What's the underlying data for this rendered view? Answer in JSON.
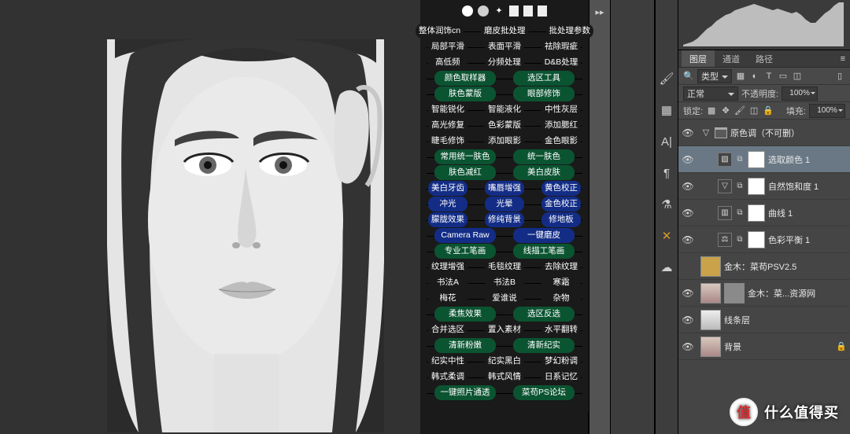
{
  "watermark": {
    "badge": "值",
    "text": "什么值得买"
  },
  "brush_presets": [
    "soft",
    "hard",
    "spark",
    "gauss",
    "streak",
    "streak2"
  ],
  "actions": [
    {
      "color": "dark",
      "cells": [
        "整体润饰cn",
        "磨皮批处理",
        "批处理参数"
      ]
    },
    {
      "color": "dark",
      "cells": [
        "局部平滑",
        "表面平滑",
        "祛除瑕疵"
      ]
    },
    {
      "color": "dark",
      "cells": [
        "高低频",
        "分频处理",
        "D&B处理"
      ]
    },
    {
      "color": "green",
      "cells": [
        "颜色取样器",
        "选区工具"
      ],
      "wide": true
    },
    {
      "color": "green",
      "cells": [
        "肤色蒙版",
        "眼部修饰"
      ],
      "wide": true
    },
    {
      "color": "dark",
      "cells": [
        "智能锐化",
        "智能液化",
        "中性灰层"
      ]
    },
    {
      "color": "dark",
      "cells": [
        "高光修复",
        "色彩蒙版",
        "添加腮红"
      ]
    },
    {
      "color": "dark",
      "cells": [
        "睫毛修饰",
        "添加眼影",
        "金色眼影"
      ]
    },
    {
      "color": "green",
      "cells": [
        "常用统一肤色",
        "统一肤色"
      ],
      "wide": true
    },
    {
      "color": "green",
      "cells": [
        "肤色减红",
        "美白皮肤"
      ],
      "wide": true
    },
    {
      "color": "blue",
      "cells": [
        "美白牙齿",
        "嘴唇增强",
        "黄色校正"
      ]
    },
    {
      "color": "blue",
      "cells": [
        "冲光",
        "光晕",
        "金色校正"
      ]
    },
    {
      "color": "blue",
      "cells": [
        "朦胧效果",
        "修纯背景",
        "修地板"
      ]
    },
    {
      "color": "blue",
      "cells": [
        "Camera Raw",
        "一键磨皮"
      ],
      "wide": true
    },
    {
      "color": "green",
      "cells": [
        "专业工笔画",
        "线描工笔画"
      ],
      "wide": true
    },
    {
      "color": "dark",
      "cells": [
        "纹理增强",
        "毛毯纹理",
        "去除纹理"
      ]
    },
    {
      "color": "dark",
      "cells": [
        "书法A",
        "书法B",
        "寒霜"
      ]
    },
    {
      "color": "dark",
      "cells": [
        "梅花",
        "爱谁说",
        "杂物"
      ]
    },
    {
      "color": "green",
      "cells": [
        "柔焦效果",
        "选区反选"
      ],
      "wide": true
    },
    {
      "color": "dark",
      "cells": [
        "合并选区",
        "置入素材",
        "水平翻转"
      ]
    },
    {
      "color": "green",
      "cells": [
        "清新粉嫩",
        "清新纪实"
      ],
      "wide": true
    },
    {
      "color": "dark",
      "cells": [
        "纪实中性",
        "纪实黑白",
        "梦幻粉调"
      ]
    },
    {
      "color": "dark",
      "cells": [
        "韩式柔调",
        "韩式风情",
        "日系记忆"
      ]
    },
    {
      "color": "green",
      "cells": [
        "一键照片通透",
        "菜苟PS论坛"
      ],
      "wide": true
    }
  ],
  "mini_strip_icons": [
    "expand"
  ],
  "collapsed_icons": [
    "brush",
    "swatches",
    "text",
    "paragraph",
    "beaker",
    "crossed",
    "cloud"
  ],
  "panel_tabs": {
    "items": [
      "图层",
      "通道",
      "路径"
    ],
    "active": 0
  },
  "filter_row": {
    "search_icon": "🔍",
    "kind_label": "类型",
    "filter_icons": [
      "image",
      "adjust",
      "text",
      "shape",
      "smart"
    ]
  },
  "blend_row": {
    "mode": "正常",
    "opacity_label": "不透明度:",
    "opacity_value": "100%"
  },
  "lock_row": {
    "lock_label": "锁定:",
    "lock_icons": [
      "image",
      "pos",
      "brush",
      "move",
      "all"
    ],
    "fill_label": "填充:",
    "fill_value": "100%"
  },
  "layers": [
    {
      "eye": true,
      "indent": 0,
      "kind": "group",
      "chev": "▽",
      "name": "原色调（不可删）"
    },
    {
      "eye": true,
      "indent": 1,
      "kind": "adj",
      "icon": "▧",
      "link": true,
      "name": "选取颜色 1",
      "selected": true
    },
    {
      "eye": true,
      "indent": 1,
      "kind": "adj",
      "icon": "▽",
      "link": true,
      "name": "自然饱和度 1"
    },
    {
      "eye": true,
      "indent": 1,
      "kind": "adj",
      "icon": "▥",
      "link": true,
      "name": "曲线 1"
    },
    {
      "eye": true,
      "indent": 1,
      "kind": "adj",
      "icon": "⚖",
      "link": true,
      "name": "色彩平衡 1"
    },
    {
      "eye": false,
      "indent": 0,
      "kind": "pixel",
      "thumb": "gold",
      "name": "金木：菜苟PSV2.5"
    },
    {
      "eye": true,
      "indent": 0,
      "kind": "pixel-dual",
      "thumb": "face",
      "name": "金木：菜...资源网"
    },
    {
      "eye": true,
      "indent": 0,
      "kind": "pixel",
      "thumb": "bw",
      "name": "线条层"
    },
    {
      "eye": true,
      "indent": 0,
      "kind": "pixel-lock",
      "thumb": "face",
      "name": "背景"
    }
  ]
}
